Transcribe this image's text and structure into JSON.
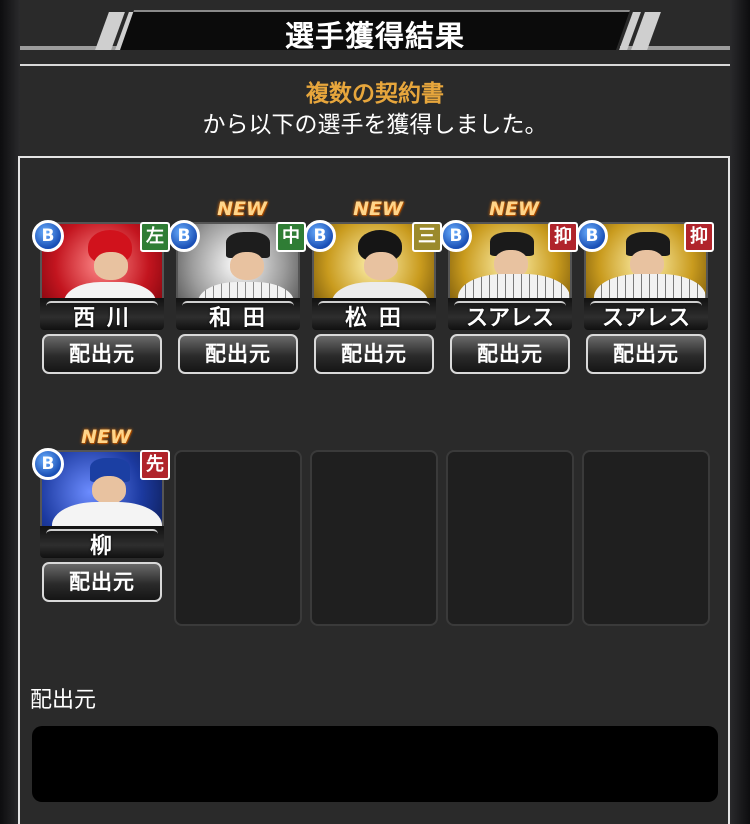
{
  "header": {
    "title": "選手獲得結果"
  },
  "message": {
    "line1": "複数の契約書",
    "line2": "から以下の選手を獲得しました。"
  },
  "cards": [
    {
      "name": "西 川",
      "rank": "B",
      "position": "左",
      "position_color": "#2f7d35",
      "new": "",
      "button": "配出元",
      "theme": "red"
    },
    {
      "name": "和 田",
      "rank": "B",
      "position": "中",
      "position_color": "#2f7d35",
      "new": "NEW",
      "button": "配出元",
      "theme": "silver"
    },
    {
      "name": "松 田",
      "rank": "B",
      "position": "三",
      "position_color": "#9b8a2c",
      "new": "NEW",
      "button": "配出元",
      "theme": "gold"
    },
    {
      "name": "スアレス",
      "rank": "B",
      "position": "抑",
      "position_color": "#b0242b",
      "new": "NEW",
      "button": "配出元",
      "theme": "gold"
    },
    {
      "name": "スアレス",
      "rank": "B",
      "position": "抑",
      "position_color": "#b0242b",
      "new": "",
      "button": "配出元",
      "theme": "gold"
    },
    {
      "name": "柳",
      "rank": "B",
      "position": "先",
      "position_color": "#b0242b",
      "new": "NEW",
      "button": "配出元",
      "theme": "blue"
    }
  ],
  "source_section": {
    "label": "配出元",
    "value": ""
  }
}
